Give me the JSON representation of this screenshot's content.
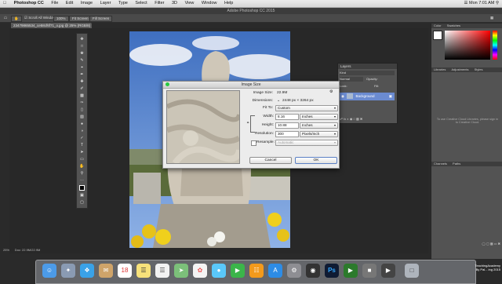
{
  "menubar": {
    "app": "Photoshop CC",
    "items": [
      "File",
      "Edit",
      "Image",
      "Layer",
      "Type",
      "Select",
      "Filter",
      "3D",
      "View",
      "Window",
      "Help"
    ],
    "clock": "Mon 7:01 AM"
  },
  "window": {
    "title": "Adobe Photoshop CC 2015"
  },
  "options": {
    "scroll_all": "Scroll All Windows",
    "zoom100": "100%",
    "fit_screen": "Fit Screen",
    "fill_screen": "Fill Screen"
  },
  "document": {
    "tab_label": "23479865534_ce58cf6f71_o.jpg @ 25% (RGB/8)"
  },
  "status": {
    "zoom": "25%",
    "doc": "Doc: 22.9M/22.9M"
  },
  "dialog": {
    "title": "Image Size",
    "image_size_label": "Image Size:",
    "image_size_value": "22.9M",
    "dimensions_label": "Dimensions:",
    "dimensions_value": "2448 px  ×  3264 px",
    "fit_to_label": "Fit To:",
    "fit_to_value": "Custom",
    "width_label": "Width:",
    "width_value": "8.16",
    "width_unit": "Inches",
    "height_label": "Height:",
    "height_value": "10.88",
    "height_unit": "Inches",
    "resolution_label": "Resolution:",
    "resolution_value": "300",
    "resolution_unit": "Pixels/Inch",
    "resample_label": "Resample:",
    "resample_value": "Automatic",
    "cancel_label": "Cancel",
    "ok_label": "OK"
  },
  "layers_panel": {
    "tab": "Layers",
    "kind": "Kind",
    "blend": "Normal",
    "opacity": "Opacity:",
    "lock": "Lock:",
    "fill": "Fill:",
    "layer_name": "Background"
  },
  "right_panel": {
    "color_tabs": [
      "Color",
      "Swatches"
    ],
    "lib_tabs": [
      "Libraries",
      "Adjustments",
      "Styles"
    ],
    "lib_message": "To use Creative Cloud Libraries, please sign in to Creative Cloud.",
    "channel_tabs": [
      "Channels",
      "Paths"
    ]
  },
  "watermark": [
    "TeachingAcademy",
    "By Pal... ing 2015"
  ],
  "dock_icons": [
    "finder-icon",
    "launchpad-icon",
    "safari-icon",
    "mail-icon",
    "calendar-icon",
    "notes-icon",
    "reminders-icon",
    "maps-icon",
    "photos-icon",
    "messages-icon",
    "facetime-icon",
    "ibooks-icon",
    "appstore-icon",
    "preferences-icon",
    "dvd-icon",
    "photoshop-icon",
    "camtasia-icon",
    "utility-icon",
    "screencast-icon",
    "trash-icon"
  ],
  "colors": {
    "accent": "#6b8bd1",
    "dialog_bg": "#ececec",
    "panel": "#535353"
  }
}
